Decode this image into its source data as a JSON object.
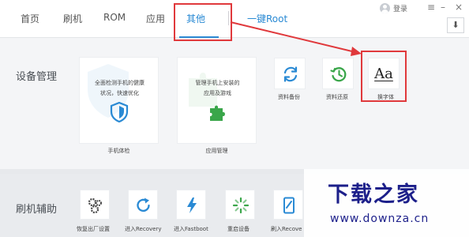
{
  "nav": {
    "tabs": [
      {
        "label": "首页"
      },
      {
        "label": "刷机"
      },
      {
        "label": "ROM"
      },
      {
        "label": "应用"
      },
      {
        "label": "其他"
      },
      {
        "label": "一键Root"
      }
    ],
    "active_tab": "其他",
    "login_label": "登录",
    "menu_icon": "hamburger-icon",
    "minimize_icon": "minimize-icon",
    "close_icon": "close-icon",
    "download_icon": "download-arrow-icon"
  },
  "device_management": {
    "title": "设备管理",
    "big_cards": [
      {
        "desc_line1": "全面检测手机的健康",
        "desc_line2": "状况，快速优化",
        "label": "手机体检",
        "icon": "shield-icon"
      },
      {
        "desc_line1": "管理手机上安装的",
        "desc_line2": "应用及游戏",
        "label": "应用管理",
        "icon": "puzzle-icon"
      }
    ],
    "small_cards": [
      {
        "label": "资料备份",
        "icon": "sync-icon"
      },
      {
        "label": "资料还原",
        "icon": "restore-clock-icon"
      },
      {
        "label": "换字体",
        "icon": "font-icon",
        "glyph": "Aa"
      }
    ]
  },
  "flash_assist": {
    "title": "刷机辅助",
    "tools": [
      {
        "label": "恢复出厂设置",
        "icon": "gears-icon"
      },
      {
        "label": "进入Recovery",
        "icon": "refresh-icon"
      },
      {
        "label": "进入Fastboot",
        "icon": "lightning-icon"
      },
      {
        "label": "重启设备",
        "icon": "loading-spinner-icon"
      },
      {
        "label": "刷入Recove",
        "icon": "phone-edit-icon"
      }
    ]
  },
  "watermark": {
    "title": "下载之家",
    "url": "www.downza.cn"
  },
  "colors": {
    "accent": "#2a8ad4",
    "highlight_box": "#e0393c",
    "arrow": "#e0393c",
    "green": "#3aa64a"
  }
}
